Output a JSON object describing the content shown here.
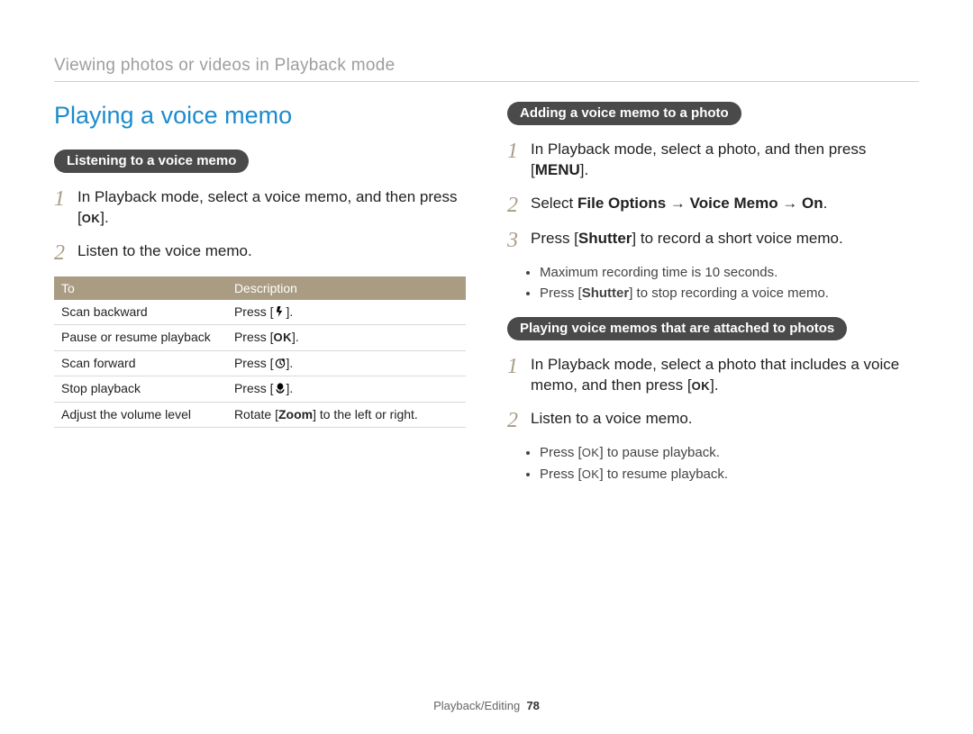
{
  "breadcrumb": "Viewing photos or videos in Playback mode",
  "section_title": "Playing a voice memo",
  "left": {
    "pill": "Listening to a voice memo",
    "step1": "In Playback mode, select a voice memo, and then press [",
    "step1_end": "].",
    "step2": "Listen to the voice memo.",
    "table": {
      "h1": "To",
      "h2": "Description",
      "rows": [
        {
          "to": "Scan backward",
          "desc_pre": "Press [",
          "icon": "flash",
          "desc_post": "]."
        },
        {
          "to": "Pause or resume playback",
          "desc_pre": "Press [",
          "icon": "ok",
          "desc_post": "]."
        },
        {
          "to": "Scan forward",
          "desc_pre": "Press [",
          "icon": "timer",
          "desc_post": "]."
        },
        {
          "to": "Stop playback",
          "desc_pre": "Press [",
          "icon": "macro",
          "desc_post": "]."
        },
        {
          "to": "Adjust the volume level",
          "desc_plain_pre": "Rotate [",
          "desc_bold": "Zoom",
          "desc_plain_post": "] to the left or right."
        }
      ]
    }
  },
  "right": {
    "pill1": "Adding a voice memo to a photo",
    "r1_step1_a": "In Playback mode, select a photo, and then press [",
    "r1_step1_menu": "MENU",
    "r1_step1_b": "].",
    "r1_step2_a": "Select ",
    "r1_step2_b": "File Options → Voice Memo → On",
    "r1_step2_c": ".",
    "r1_step3_a": "Press [",
    "r1_step3_b": "Shutter",
    "r1_step3_c": "] to record a short voice memo.",
    "r1_bullets": [
      "Maximum recording time is 10 seconds.",
      "Press [Shutter] to stop recording a voice memo."
    ],
    "pill2": "Playing voice memos that are attached to photos",
    "r2_step1_a": "In Playback mode, select a photo that includes a voice memo, and then press [",
    "r2_step1_b": "].",
    "r2_step2": "Listen to a voice memo.",
    "r2_bullets_pre": "Press [",
    "r2_bullets": [
      "] to pause playback.",
      "] to resume playback."
    ]
  },
  "footer_section": "Playback/Editing",
  "footer_page": "78"
}
